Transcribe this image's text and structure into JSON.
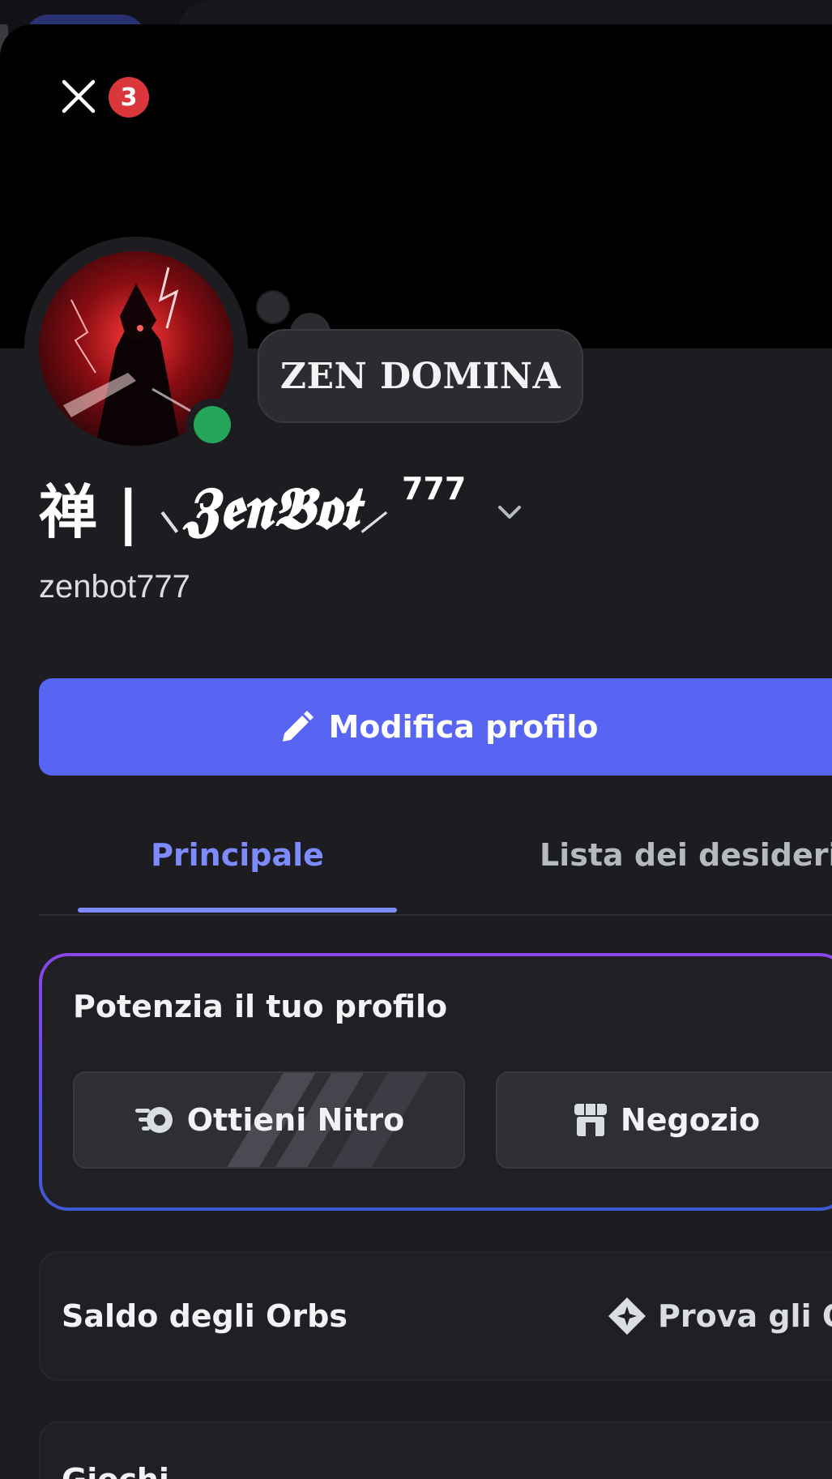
{
  "notifications": {
    "count": "3"
  },
  "profile": {
    "custom_status": "ZEN DOMINA",
    "display_name_prefix": "禅 |",
    "display_name_main": "𝖅𝖊𝖓𝕭𝖔𝖙",
    "display_name_suffix": "777",
    "username": "zenbot777"
  },
  "actions": {
    "edit_profile": "Modifica profilo"
  },
  "tabs": {
    "main": "Principale",
    "wishlist": "Lista dei desideri"
  },
  "boost": {
    "title": "Potenzia il tuo profilo",
    "nitro_label": "Ottieni Nitro",
    "shop_label": "Negozio"
  },
  "orbs": {
    "title": "Saldo degli Orbs",
    "link": "Prova gli Orbs"
  },
  "games": {
    "title": "Giochi"
  },
  "colors": {
    "accent": "#5865f2",
    "tab_active": "#7d8bff",
    "online": "#23a55a",
    "badge": "#da373c"
  }
}
